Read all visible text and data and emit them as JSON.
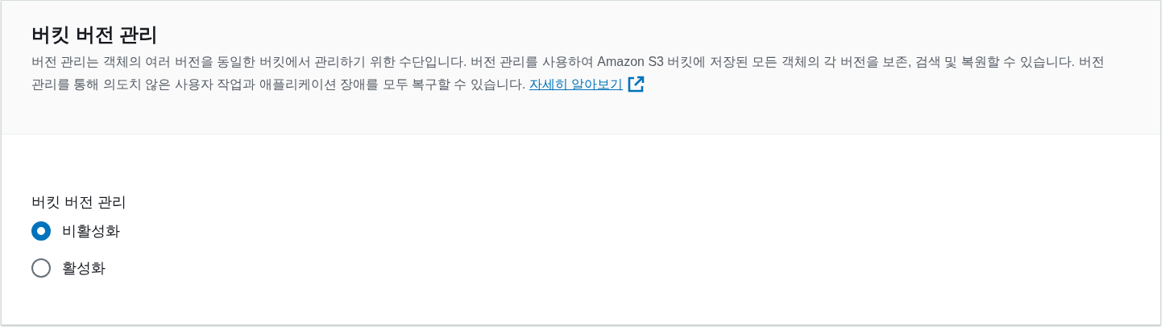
{
  "header": {
    "title": "버킷 버전 관리",
    "description": "버전 관리는 객체의 여러 버전을 동일한 버킷에서 관리하기 위한 수단입니다. 버전 관리를 사용하여 Amazon S3 버킷에 저장된 모든 객체의 각 버전을 보존, 검색 및 복원할 수 있습니다. 버전 관리를 통해 의도치 않은 사용자 작업과 애플리케이션 장애를 모두 복구할 수 있습니다.",
    "link": "자세히 알아보기"
  },
  "field": {
    "label": "버킷 버전 관리",
    "options": [
      {
        "label": "비활성화",
        "selected": true
      },
      {
        "label": "활성화",
        "selected": false
      }
    ]
  }
}
